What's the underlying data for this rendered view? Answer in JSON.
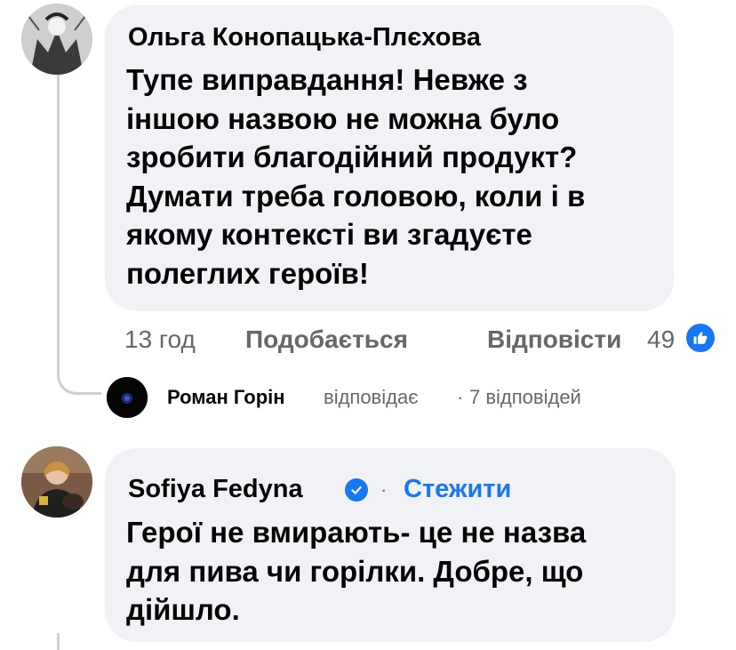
{
  "comment1": {
    "author": "Ольга Конопацька-Плєхова",
    "lines": [
      "Тупе виправдання! Невже з",
      "іншою назвою не можна було",
      "зробити благодійний продукт?",
      "Думати треба головою, коли і в",
      "якому контексті ви згадуєте",
      "полеглих  героїв!"
    ],
    "time": "13 год",
    "like_label": "Подобається",
    "reply_label": "Відповісти",
    "reaction_count": "49",
    "reaction_icon": "thumbs-up-icon"
  },
  "reply_summary": {
    "author": "Роман Горін",
    "action": "відповідає",
    "separator": "·",
    "count_text": "7 відповідей"
  },
  "comment2": {
    "author": "Sofiya Fedyna",
    "separator": "·",
    "follow_label": "Стежити",
    "verified_icon": "verified-badge-icon",
    "lines": [
      "Герої не вмирають- це не назва",
      "для пива чи горілки. Добре, що",
      "дійшло."
    ]
  },
  "colors": {
    "bubble": "#f0f2f5",
    "meta_text": "#65676b",
    "accent": "#1877f2",
    "thread_line": "#ced0d4"
  }
}
